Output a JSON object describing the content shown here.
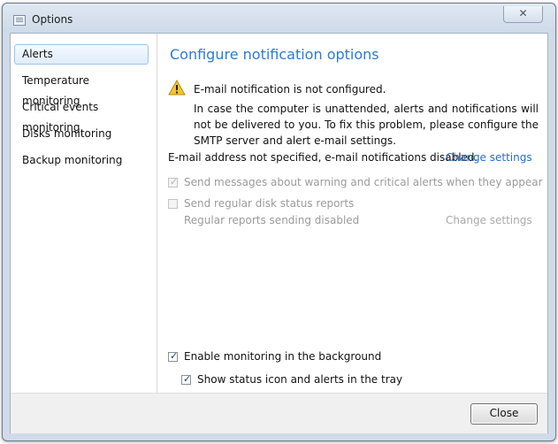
{
  "window": {
    "title": "Options",
    "close_glyph": "✕"
  },
  "sidebar": {
    "items": [
      {
        "label": "Alerts",
        "active": true
      },
      {
        "label": "Temperature monitoring"
      },
      {
        "label": "Critical events monitoring"
      },
      {
        "label": "Disks monitoring"
      },
      {
        "label": "Backup monitoring"
      }
    ]
  },
  "content": {
    "heading": "Configure notification options",
    "warning": {
      "icon": "warning-icon",
      "title": "E-mail notification is not configured.",
      "body": "In case the computer is unattended, alerts and notifications will not be delivered to you. To fix this problem, please configure the SMTP server and alert e-mail settings."
    },
    "email_status": "E-mail address not specified, e-mail notifications disabled.",
    "change_settings_link": "Change settings",
    "send_messages": {
      "label": "Send messages about warning and critical alerts when they appear",
      "checked": true,
      "enabled": false
    },
    "send_reports": {
      "label": "Send regular disk status reports",
      "checked": false,
      "enabled": false
    },
    "reports_status": "Regular reports sending disabled",
    "reports_change_link": "Change settings",
    "enable_monitoring": {
      "label": "Enable monitoring in the background",
      "checked": true
    },
    "show_tray": {
      "label": "Show status icon and alerts in the tray",
      "checked": true
    }
  },
  "footer": {
    "close_label": "Close"
  },
  "colors": {
    "accent": "#2a7bd4",
    "link": "#1f6fd0",
    "disabled": "#9a9a9a"
  }
}
